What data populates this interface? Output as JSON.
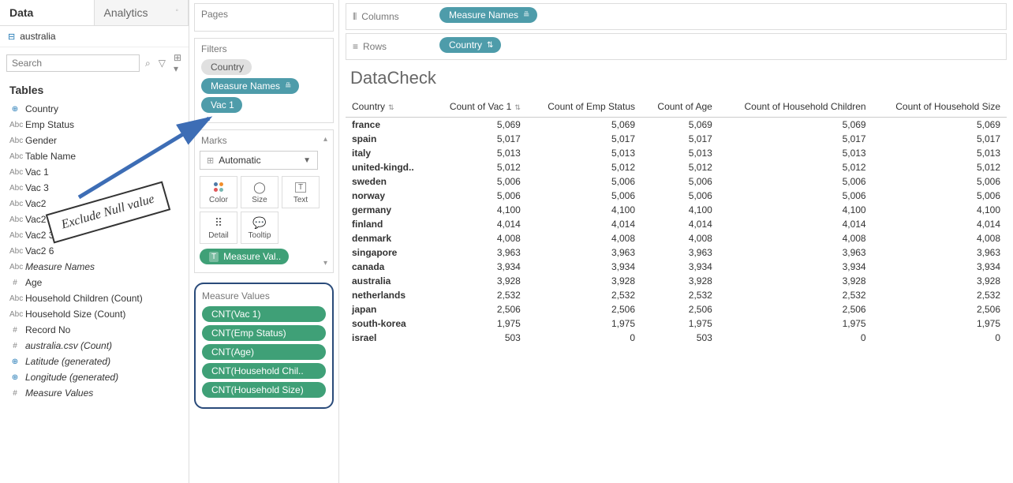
{
  "sidebar": {
    "tabs": {
      "data": "Data",
      "analytics": "Analytics"
    },
    "datasource": "australia",
    "search_placeholder": "Search",
    "tables_header": "Tables",
    "fields": [
      {
        "icon": "⊕",
        "cls": "geo",
        "label": "Country"
      },
      {
        "icon": "Abc",
        "cls": "",
        "label": "Emp Status"
      },
      {
        "icon": "Abc",
        "cls": "",
        "label": "Gender"
      },
      {
        "icon": "Abc",
        "cls": "",
        "label": "Table Name"
      },
      {
        "icon": "Abc",
        "cls": "",
        "label": "Vac 1"
      },
      {
        "icon": "Abc",
        "cls": "",
        "label": "Vac 3"
      },
      {
        "icon": "Abc",
        "cls": "",
        "label": "Vac2"
      },
      {
        "icon": "Abc",
        "cls": "",
        "label": "Vac2"
      },
      {
        "icon": "Abc",
        "cls": "",
        "label": "Vac2 3"
      },
      {
        "icon": "Abc",
        "cls": "",
        "label": "Vac2 6"
      },
      {
        "icon": "Abc",
        "cls": "",
        "label": "Measure Names",
        "italic": true
      },
      {
        "icon": "#",
        "cls": "",
        "label": "Age"
      },
      {
        "icon": "Abc",
        "cls": "",
        "label": "Household Children (Count)"
      },
      {
        "icon": "Abc",
        "cls": "",
        "label": "Household Size (Count)"
      },
      {
        "icon": "#",
        "cls": "",
        "label": "Record No"
      },
      {
        "icon": "#",
        "cls": "",
        "label": "australia.csv (Count)",
        "italic": true
      },
      {
        "icon": "⊕",
        "cls": "geo",
        "label": "Latitude (generated)",
        "italic": true
      },
      {
        "icon": "⊕",
        "cls": "geo",
        "label": "Longitude (generated)",
        "italic": true
      },
      {
        "icon": "#",
        "cls": "",
        "label": "Measure Values",
        "italic": true
      }
    ]
  },
  "mid": {
    "pages_title": "Pages",
    "filters_title": "Filters",
    "filters": [
      {
        "label": "Country",
        "cls": "gray"
      },
      {
        "label": "Measure Names",
        "cls": "teal",
        "sort": true
      },
      {
        "label": "Vac 1",
        "cls": "teal"
      }
    ],
    "marks_title": "Marks",
    "marks_type": "Automatic",
    "mark_buttons": [
      {
        "id": "color",
        "label": "Color"
      },
      {
        "id": "size",
        "label": "Size"
      },
      {
        "id": "text",
        "label": "Text"
      },
      {
        "id": "detail",
        "label": "Detail"
      },
      {
        "id": "tooltip",
        "label": "Tooltip"
      }
    ],
    "marks_text_pill": "Measure Val..",
    "measure_values_title": "Measure Values",
    "measure_values": [
      "CNT(Vac 1)",
      "CNT(Emp Status)",
      "CNT(Age)",
      "CNT(Household Chil..",
      "CNT(Household Size)"
    ]
  },
  "shelves": {
    "columns_label": "Columns",
    "columns_pill": "Measure Names",
    "rows_label": "Rows",
    "rows_pill": "Country"
  },
  "viz": {
    "title": "DataCheck",
    "headers": [
      "Country",
      "Count of Vac 1",
      "Count of Emp Status",
      "Count of Age",
      "Count of Household Children",
      "Count of Household Size"
    ],
    "rows": [
      {
        "c": "france",
        "v": [
          5069,
          5069,
          5069,
          5069,
          5069
        ]
      },
      {
        "c": "spain",
        "v": [
          5017,
          5017,
          5017,
          5017,
          5017
        ]
      },
      {
        "c": "italy",
        "v": [
          5013,
          5013,
          5013,
          5013,
          5013
        ]
      },
      {
        "c": "united-kingd..",
        "v": [
          5012,
          5012,
          5012,
          5012,
          5012
        ]
      },
      {
        "c": "sweden",
        "v": [
          5006,
          5006,
          5006,
          5006,
          5006
        ]
      },
      {
        "c": "norway",
        "v": [
          5006,
          5006,
          5006,
          5006,
          5006
        ]
      },
      {
        "c": "germany",
        "v": [
          4100,
          4100,
          4100,
          4100,
          4100
        ]
      },
      {
        "c": "finland",
        "v": [
          4014,
          4014,
          4014,
          4014,
          4014
        ]
      },
      {
        "c": "denmark",
        "v": [
          4008,
          4008,
          4008,
          4008,
          4008
        ]
      },
      {
        "c": "singapore",
        "v": [
          3963,
          3963,
          3963,
          3963,
          3963
        ]
      },
      {
        "c": "canada",
        "v": [
          3934,
          3934,
          3934,
          3934,
          3934
        ]
      },
      {
        "c": "australia",
        "v": [
          3928,
          3928,
          3928,
          3928,
          3928
        ]
      },
      {
        "c": "netherlands",
        "v": [
          2532,
          2532,
          2532,
          2532,
          2532
        ]
      },
      {
        "c": "japan",
        "v": [
          2506,
          2506,
          2506,
          2506,
          2506
        ]
      },
      {
        "c": "south-korea",
        "v": [
          1975,
          1975,
          1975,
          1975,
          1975
        ]
      },
      {
        "c": "israel",
        "v": [
          503,
          0,
          503,
          0,
          0
        ]
      }
    ]
  },
  "annotation": {
    "text": "Exclude Null value"
  },
  "chart_data": {
    "type": "table",
    "title": "DataCheck",
    "columns": [
      "Country",
      "Count of Vac 1",
      "Count of Emp Status",
      "Count of Age",
      "Count of Household Children",
      "Count of Household Size"
    ],
    "rows": [
      [
        "france",
        5069,
        5069,
        5069,
        5069,
        5069
      ],
      [
        "spain",
        5017,
        5017,
        5017,
        5017,
        5017
      ],
      [
        "italy",
        5013,
        5013,
        5013,
        5013,
        5013
      ],
      [
        "united-kingdom",
        5012,
        5012,
        5012,
        5012,
        5012
      ],
      [
        "sweden",
        5006,
        5006,
        5006,
        5006,
        5006
      ],
      [
        "norway",
        5006,
        5006,
        5006,
        5006,
        5006
      ],
      [
        "germany",
        4100,
        4100,
        4100,
        4100,
        4100
      ],
      [
        "finland",
        4014,
        4014,
        4014,
        4014,
        4014
      ],
      [
        "denmark",
        4008,
        4008,
        4008,
        4008,
        4008
      ],
      [
        "singapore",
        3963,
        3963,
        3963,
        3963,
        3963
      ],
      [
        "canada",
        3934,
        3934,
        3934,
        3934,
        3934
      ],
      [
        "australia",
        3928,
        3928,
        3928,
        3928,
        3928
      ],
      [
        "netherlands",
        2532,
        2532,
        2532,
        2532,
        2532
      ],
      [
        "japan",
        2506,
        2506,
        2506,
        2506,
        2506
      ],
      [
        "south-korea",
        1975,
        1975,
        1975,
        1975,
        1975
      ],
      [
        "israel",
        503,
        0,
        503,
        0,
        0
      ]
    ]
  }
}
